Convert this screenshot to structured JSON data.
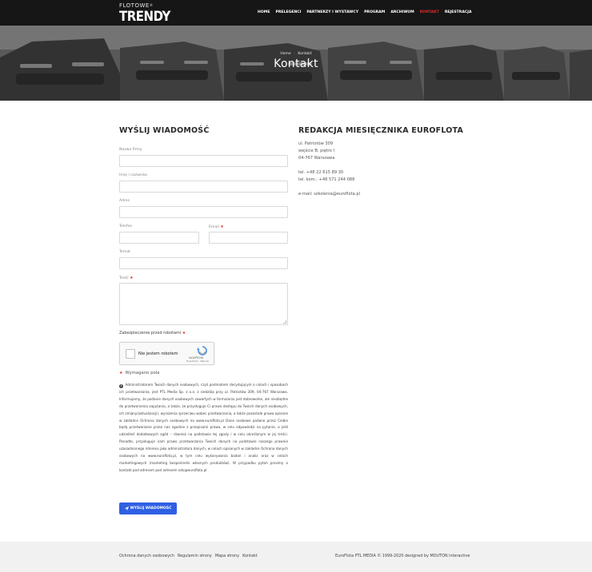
{
  "nav": {
    "logo_top": "FLOTOWE",
    "logo_main": "TRENDY",
    "logo_mark": "®",
    "items": [
      {
        "label": "HOME",
        "active": false
      },
      {
        "label": "PRELEGENCI",
        "active": false
      },
      {
        "label": "PARTNERZY I WYSTAWCY",
        "active": false
      },
      {
        "label": "PROGRAM",
        "active": false
      },
      {
        "label": "ARCHIWUM",
        "active": false
      },
      {
        "label": "KONTAKT",
        "active": true
      },
      {
        "label": "REJESTRACJA",
        "active": false
      }
    ]
  },
  "hero": {
    "breadcrumb_home": "Home",
    "breadcrumb_sep": "›",
    "breadcrumb_current": "Kontakt",
    "title": "Kontakt"
  },
  "form": {
    "title": "WYŚLIJ WIADOMOŚĆ",
    "company_label": "Nazwa firmy",
    "name_label": "Imię i nazwisko",
    "address_label": "Adres",
    "phone_label": "Telefon",
    "email_label": "Email",
    "subject_label": "Temat",
    "message_label": "Treść",
    "required_mark": "★",
    "captcha_label": "Zabezpieczenie przed robotami",
    "captcha_text": "Nie jestem robotem",
    "captcha_brand": "reCAPTCHA",
    "captcha_links": "Prywatność - Warunki",
    "required_note": "Wymagane pola",
    "gdpr": "Administratorem Twoich danych osobowych, czyli podmiotem decydującym o celach i sposobach ich przetwarzania, jest PTL Media Sp. z o.o. z siedzibą przy ul. Patriotów 309, 04-767 Warszawa. Informujemy, że podanie danych osobowych zawartych w formularzu jest dobrowolne, ale niezbędne do przetworzenia zapytania, a także, że przysługuje Ci prawo dostępu do Twoich danych osobowych, ich zmiany(aktualizacji), wyrażenia sprzeciwu wobec przetwarzania, a także pozostałe prawa opisane w zakładce Ochrona danych osobowych na www.euroflota.pl Dane osobowe podane przez Ciebie będą przetwarzane przez nas zgodnie z przepisami prawa, w celu odpowiedzi na pytanie, a jeśli udzieliłeś dodatkowych zgód – również na podstawie tej zgody i w celu określonym w jej treści. Ponadto, przysługuje nam prawo przetwarzania Twoich danych na podstawie naszego prawnie uzasadnionego interesu jako administratora danych, w celach opisanych w zakładce Ochrona danych osobowych na www.euroflota.pl, w tym celu wykonywania badań i analiz oraz w celach marketingowych (marketing bezpośredni własnych produktów). W przypadku pytań prosimy o kontakt pod adresem pod adresem odo@euroflota.pl",
    "submit_label": "WYŚLIJ WIADOMOŚĆ"
  },
  "contact": {
    "title": "REDAKCJA MIESIĘCZNIKA EUROFLOTA",
    "street": "ul. Patriotów 309",
    "entrance": "wejście B; piętro I",
    "city": "04-767 Warszawa",
    "phone": "tel. +48 22 615 89 30",
    "mobile": "tel. kom.: +48 571 244 088",
    "email": "e-mail: szkolenia@euroflota.pl"
  },
  "footer": {
    "links": [
      "Ochrona danych osobowych",
      "Regulamin strony",
      "Mapa strony",
      "Kontakt"
    ],
    "copyright": "EuroFlota PTL MEDIA © 1999-2020 designed by MOUTON interactive"
  },
  "colors": {
    "accent": "#e12a2a",
    "button": "#2f5fe3",
    "topbar": "#161616",
    "footer": "#f1f1f1"
  }
}
